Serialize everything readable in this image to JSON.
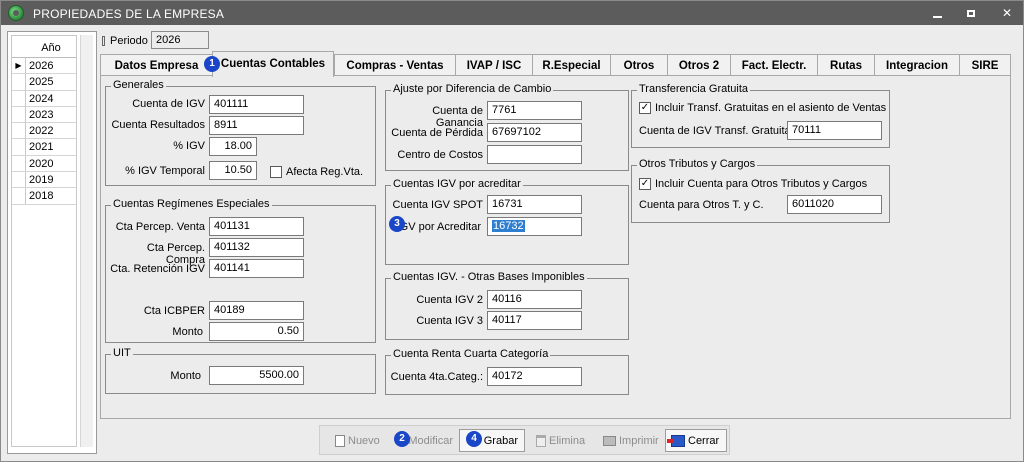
{
  "window": {
    "title": "PROPIEDADES DE LA EMPRESA"
  },
  "years": {
    "header": "Año",
    "items": [
      "2026",
      "2025",
      "2024",
      "2023",
      "2022",
      "2021",
      "2020",
      "2019",
      "2018"
    ],
    "selected": "2026"
  },
  "period": {
    "label": "Periodo",
    "value": "2026"
  },
  "tabs": [
    "Datos Empresa",
    "Cuentas Contables",
    "Compras - Ventas",
    "IVAP / ISC",
    "R.Especial",
    "Otros",
    "Otros 2",
    "Fact. Electr.",
    "Rutas",
    "Integracion",
    "SIRE"
  ],
  "active_tab": "Cuentas Contables",
  "generales": {
    "legend": "Generales",
    "cuenta_igv_label": "Cuenta de IGV",
    "cuenta_igv": "401111",
    "cuenta_resultados_label": "Cuenta Resultados",
    "cuenta_resultados": "8911",
    "pct_igv_label": "% IGV",
    "pct_igv": "18.00",
    "pct_igv_temporal_label": "% IGV Temporal",
    "pct_igv_temporal": "10.50",
    "afecta_reg_vta_label": "Afecta Reg.Vta.",
    "afecta_reg_vta_checked": false
  },
  "regimenes": {
    "legend": "Cuentas Regímenes Especiales",
    "percep_venta_label": "Cta Percep. Venta",
    "percep_venta": "401131",
    "percep_compra_label": "Cta Percep. Compra",
    "percep_compra": "401132",
    "retencion_label": "Cta. Retención IGV",
    "retencion": "401141",
    "icbper_label": "Cta ICBPER",
    "icbper": "40189",
    "monto_label": "Monto",
    "monto": "0.50"
  },
  "uit": {
    "legend": "UIT",
    "monto_label": "Monto",
    "monto": "5500.00"
  },
  "ajuste": {
    "legend": "Ajuste por Diferencia de Cambio",
    "ganancia_label": "Cuenta de Ganancia",
    "ganancia": "7761",
    "perdida_label": "Cuenta de Pérdida",
    "perdida": "67697102",
    "centro_costos_label": "Centro de Costos",
    "centro_costos": ""
  },
  "igv_acreditar": {
    "legend": "Cuentas IGV por acreditar",
    "spot_label": "Cuenta IGV SPOT",
    "spot": "16731",
    "acreditar_label": "IGV por Acreditar",
    "acreditar": "16732"
  },
  "otras_bases": {
    "legend": "Cuentas IGV. - Otras Bases Imponibles",
    "igv2_label": "Cuenta IGV 2",
    "igv2": "40116",
    "igv3_label": "Cuenta IGV 3",
    "igv3": "40117"
  },
  "renta_cuarta": {
    "legend": "Cuenta Renta Cuarta Categoría",
    "label": "Cuenta 4ta.Categ.:",
    "value": "40172"
  },
  "transferencia": {
    "legend": "Transferencia Gratuita",
    "incluir_label": "Incluir Transf. Gratuitas en el asiento de Ventas",
    "incluir_checked": true,
    "cuenta_label": "Cuenta de IGV Transf. Gratuita",
    "cuenta": "70111"
  },
  "otros_tributos": {
    "legend": "Otros Tributos y Cargos",
    "incluir_label": "Incluir Cuenta para Otros Tributos y Cargos",
    "incluir_checked": true,
    "cuenta_label": "Cuenta para Otros T. y C.",
    "cuenta": "6011020"
  },
  "toolbar": {
    "nuevo": "Nuevo",
    "modificar": "Modificar",
    "grabar": "Grabar",
    "elimina": "Elimina",
    "imprimir": "Imprimir",
    "cerrar": "Cerrar"
  },
  "badges": {
    "b1": "1",
    "b2": "2",
    "b3": "3",
    "b4": "4"
  },
  "icons": {
    "app": "app-logo-icon",
    "minimize": "minimize-icon",
    "maximize": "maximize-icon",
    "close": "close-icon",
    "row_indicator": "row-pointer-icon"
  },
  "colors": {
    "titlebar": "#5c5c5c",
    "badge": "#1a46c8",
    "selection": "#2f7fd0"
  }
}
